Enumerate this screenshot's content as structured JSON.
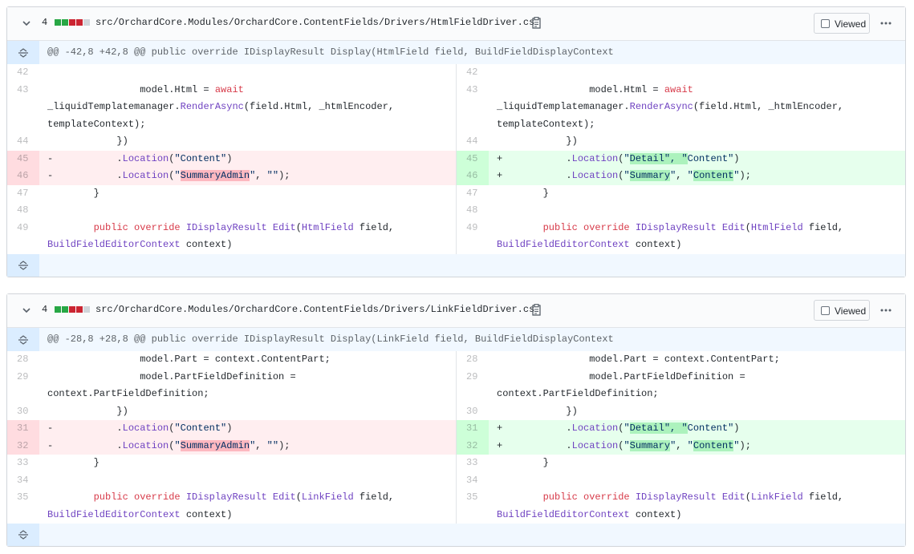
{
  "files": [
    {
      "count": "4",
      "path": "src/OrchardCore.Modules/OrchardCore.ContentFields/Drivers/HtmlFieldDriver.cs",
      "viewed_label": "Viewed",
      "hunk": "@@ -42,8 +42,8 @@ public override IDisplayResult Display(HtmlField field, BuildFieldDisplayContext",
      "left": [
        {
          "n": "42",
          "t": "ctx",
          "html": ""
        },
        {
          "n": "43",
          "t": "ctx",
          "html": "                model.Html = <span class=\"kw\">await</span>\n_liquidTemplatemanager.<span class=\"fn\">RenderAsync</span>(field.Html, _htmlEncoder,\ntemplateContext);"
        },
        {
          "n": "44",
          "t": "ctx",
          "html": "            })"
        },
        {
          "n": "45",
          "t": "del",
          "html": "-           .<span class=\"fn\">Location</span>(<span class=\"str\">\"Content\"</span>)"
        },
        {
          "n": "46",
          "t": "del",
          "html": "-           .<span class=\"fn\">Location</span>(<span class=\"str\">\"<span class=\"mark-del\">SummaryAdmin</span>\"</span>, <span class=\"str\">\"\"</span>);"
        },
        {
          "n": "47",
          "t": "ctx",
          "html": "        }"
        },
        {
          "n": "48",
          "t": "ctx",
          "html": ""
        },
        {
          "n": "49",
          "t": "ctx",
          "html": "        <span class=\"kw\">public override</span> <span class=\"fn\">IDisplayResult</span> <span class=\"fn\">Edit</span>(<span class=\"fn\">HtmlField</span> field,\n<span class=\"fn\">BuildFieldEditorContext</span> context)"
        }
      ],
      "right": [
        {
          "n": "42",
          "t": "ctx",
          "html": ""
        },
        {
          "n": "43",
          "t": "ctx",
          "html": "                model.Html = <span class=\"kw\">await</span>\n_liquidTemplatemanager.<span class=\"fn\">RenderAsync</span>(field.Html, _htmlEncoder,\ntemplateContext);"
        },
        {
          "n": "44",
          "t": "ctx",
          "html": "            })"
        },
        {
          "n": "45",
          "t": "add",
          "html": "+           .<span class=\"fn\">Location</span>(<span class=\"str\">\"<span class=\"mark-add\">Detail\", \"</span>Content\"</span>)"
        },
        {
          "n": "46",
          "t": "add",
          "html": "+           .<span class=\"fn\">Location</span>(<span class=\"str\">\"<span class=\"mark-add\">Summary</span>\"</span>, <span class=\"str\">\"<span class=\"mark-add\">Content</span>\"</span>);"
        },
        {
          "n": "47",
          "t": "ctx",
          "html": "        }"
        },
        {
          "n": "48",
          "t": "ctx",
          "html": ""
        },
        {
          "n": "49",
          "t": "ctx",
          "html": "        <span class=\"kw\">public override</span> <span class=\"fn\">IDisplayResult</span> <span class=\"fn\">Edit</span>(<span class=\"fn\">HtmlField</span> field,\n<span class=\"fn\">BuildFieldEditorContext</span> context)"
        }
      ]
    },
    {
      "count": "4",
      "path": "src/OrchardCore.Modules/OrchardCore.ContentFields/Drivers/LinkFieldDriver.cs",
      "viewed_label": "Viewed",
      "hunk": "@@ -28,8 +28,8 @@ public override IDisplayResult Display(LinkField field, BuildFieldDisplayContext",
      "left": [
        {
          "n": "28",
          "t": "ctx",
          "html": "                model.Part = context.ContentPart;"
        },
        {
          "n": "29",
          "t": "ctx",
          "html": "                model.PartFieldDefinition =\ncontext.PartFieldDefinition;"
        },
        {
          "n": "30",
          "t": "ctx",
          "html": "            })"
        },
        {
          "n": "31",
          "t": "del",
          "html": "-           .<span class=\"fn\">Location</span>(<span class=\"str\">\"Content\"</span>)"
        },
        {
          "n": "32",
          "t": "del",
          "html": "-           .<span class=\"fn\">Location</span>(<span class=\"str\">\"<span class=\"mark-del\">SummaryAdmin</span>\"</span>, <span class=\"str\">\"\"</span>);"
        },
        {
          "n": "33",
          "t": "ctx",
          "html": "        }"
        },
        {
          "n": "34",
          "t": "ctx",
          "html": ""
        },
        {
          "n": "35",
          "t": "ctx",
          "html": "        <span class=\"kw\">public override</span> <span class=\"fn\">IDisplayResult</span> <span class=\"fn\">Edit</span>(<span class=\"fn\">LinkField</span> field,\n<span class=\"fn\">BuildFieldEditorContext</span> context)"
        }
      ],
      "right": [
        {
          "n": "28",
          "t": "ctx",
          "html": "                model.Part = context.ContentPart;"
        },
        {
          "n": "29",
          "t": "ctx",
          "html": "                model.PartFieldDefinition =\ncontext.PartFieldDefinition;"
        },
        {
          "n": "30",
          "t": "ctx",
          "html": "            })"
        },
        {
          "n": "31",
          "t": "add",
          "html": "+           .<span class=\"fn\">Location</span>(<span class=\"str\">\"<span class=\"mark-add\">Detail\", \"</span>Content\"</span>)"
        },
        {
          "n": "32",
          "t": "add",
          "html": "+           .<span class=\"fn\">Location</span>(<span class=\"str\">\"<span class=\"mark-add\">Summary</span>\"</span>, <span class=\"str\">\"<span class=\"mark-add\">Content</span>\"</span>);"
        },
        {
          "n": "33",
          "t": "ctx",
          "html": "        }"
        },
        {
          "n": "34",
          "t": "ctx",
          "html": ""
        },
        {
          "n": "35",
          "t": "ctx",
          "html": "        <span class=\"kw\">public override</span> <span class=\"fn\">IDisplayResult</span> <span class=\"fn\">Edit</span>(<span class=\"fn\">LinkField</span> field,\n<span class=\"fn\">BuildFieldEditorContext</span> context)"
        }
      ]
    }
  ],
  "colors": {
    "added": "#28a745",
    "deleted": "#cb2431",
    "neutral": "#d1d5da"
  },
  "icons": {
    "collapse": "chevron-down-icon",
    "copy": "clipboard-icon",
    "expand": "unfold-icon",
    "menu": "kebab-horizontal-icon"
  }
}
